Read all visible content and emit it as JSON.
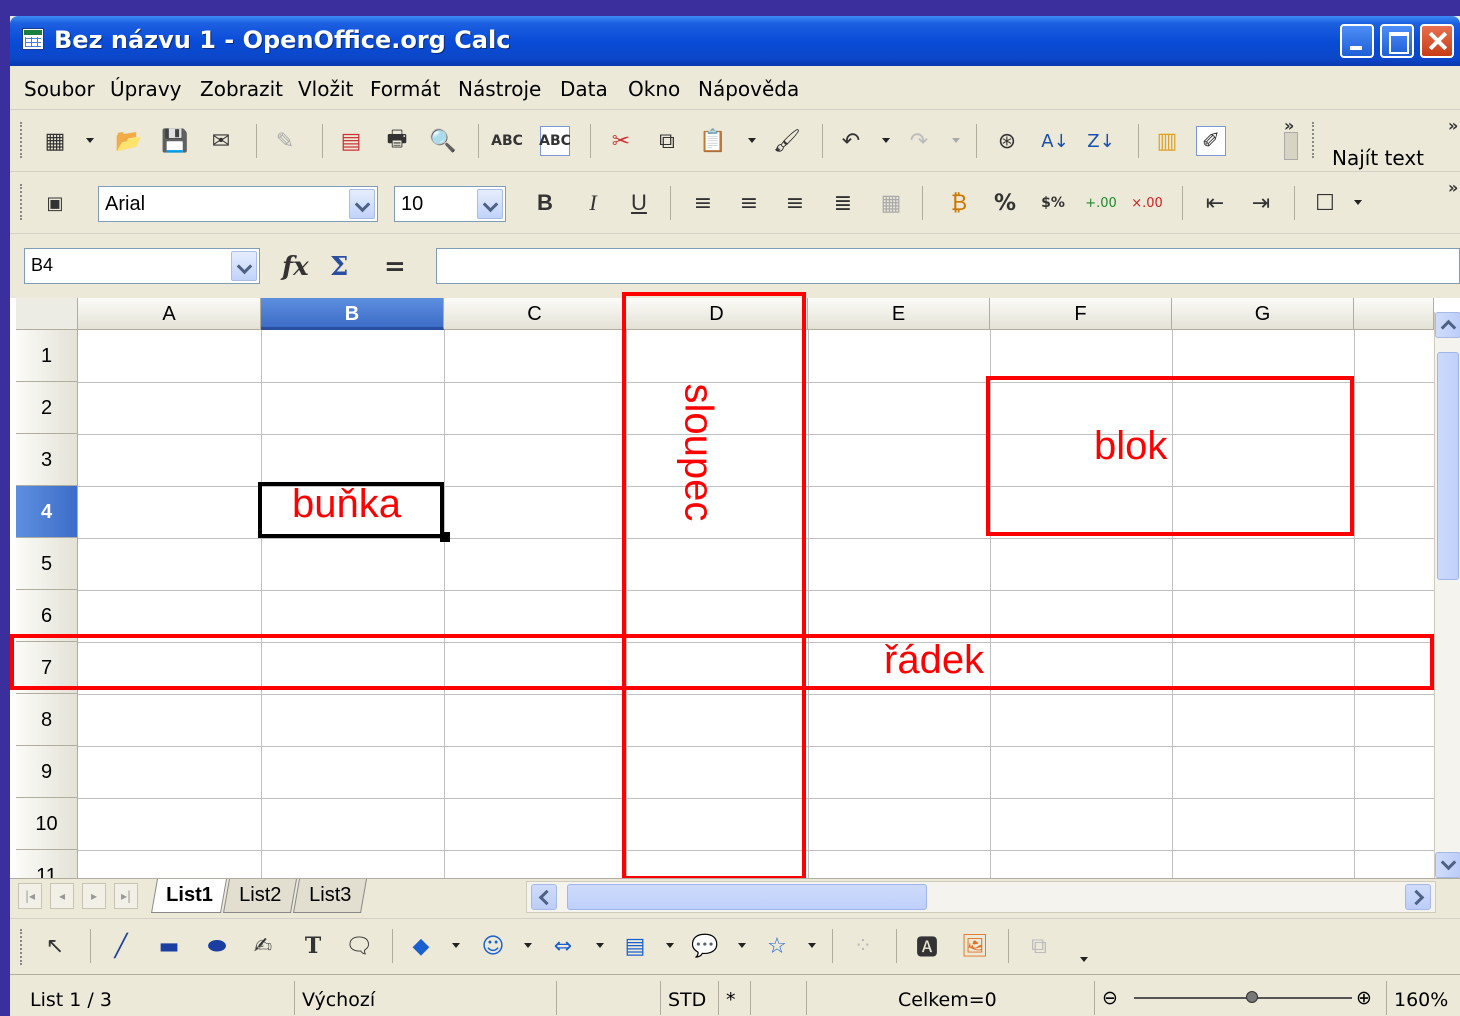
{
  "window": {
    "title": "Bez názvu 1 - OpenOffice.org Calc"
  },
  "menu": [
    "Soubor",
    "Úpravy",
    "Zobrazit",
    "Vložit",
    "Formát",
    "Nástroje",
    "Data",
    "Okno",
    "Nápověda"
  ],
  "toolbar": {
    "find_text": "Najít text"
  },
  "format_bar": {
    "font_name": "Arial",
    "font_size": "10"
  },
  "formula_bar": {
    "cell_reference": "B4",
    "formula": "",
    "sum_symbol": "Σ",
    "equals_symbol": "="
  },
  "grid": {
    "columns": [
      "A",
      "B",
      "C",
      "D",
      "E",
      "F",
      "G"
    ],
    "rows": [
      "1",
      "2",
      "3",
      "4",
      "5",
      "6",
      "7",
      "8",
      "9",
      "10",
      "11"
    ],
    "selected_column": "B",
    "selected_row": "4"
  },
  "annotations": {
    "cell": "buňka",
    "column": "sloupec",
    "block": "blok",
    "row": "řádek",
    "color": "#ff0000"
  },
  "sheets": {
    "tabs": [
      "List1",
      "List2",
      "List3"
    ],
    "active": "List1"
  },
  "status": {
    "sheet": "List 1 / 3",
    "style": "Výchozí",
    "mode": "STD",
    "modified": "*",
    "sum": "Celkem=0",
    "zoom": "160%"
  },
  "colors": {
    "titlebar": "#0a4cd8",
    "selection_header": "#3d6dc8",
    "annotation": "#ff0000"
  }
}
